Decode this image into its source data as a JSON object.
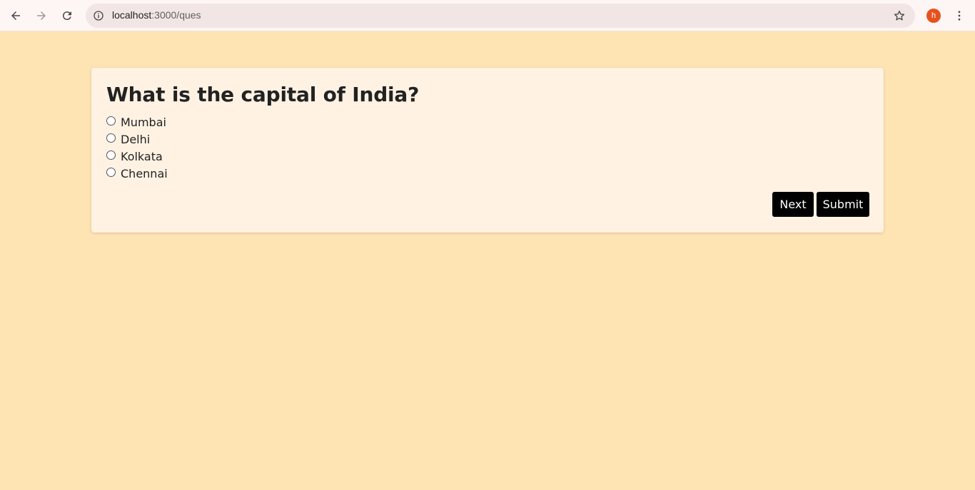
{
  "browser": {
    "url_host": "localhost",
    "url_path": ":3000/ques",
    "avatar_letter": "h"
  },
  "quiz": {
    "question": "What is the capital of India?",
    "options": [
      "Mumbai",
      "Delhi",
      "Kolkata",
      "Chennai"
    ],
    "next_label": "Next",
    "submit_label": "Submit"
  },
  "colors": {
    "page_background": "#ffe4b3",
    "card_background": "#fff2e3",
    "button_background": "#000000",
    "avatar": "#e4531f"
  }
}
